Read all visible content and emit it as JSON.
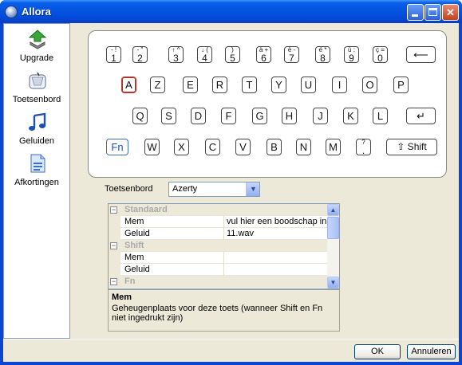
{
  "window": {
    "title": "Allora"
  },
  "sidebar": {
    "items": [
      {
        "label": "Upgrade",
        "icon": "upgrade-arrow-icon"
      },
      {
        "label": "Toetsenbord",
        "icon": "mouse-icon"
      },
      {
        "label": "Geluiden",
        "icon": "music-note-icon"
      },
      {
        "label": "Afkortingen",
        "icon": "document-icon"
      }
    ]
  },
  "keyboard": {
    "row1": [
      {
        "top": "- !",
        "bot": "1"
      },
      {
        "top": "- \"",
        "bot": "2"
      },
      {
        "top": "↑ ^",
        "bot": "3"
      },
      {
        "top": "↓ (",
        "bot": "4"
      },
      {
        "top": ")",
        "bot": "5"
      },
      {
        "top": "à +",
        "bot": "6"
      },
      {
        "top": "è -",
        "bot": "7"
      },
      {
        "top": "é *",
        "bot": "8"
      },
      {
        "top": "ù :",
        "bot": "9"
      },
      {
        "top": "ç =",
        "bot": "0"
      }
    ],
    "backspace": "⟵",
    "row2": [
      "A",
      "Z",
      "E",
      "R",
      "T",
      "Y",
      "U",
      "I",
      "O",
      "P"
    ],
    "row3": [
      "Q",
      "S",
      "D",
      "F",
      "G",
      "H",
      "J",
      "K",
      "L"
    ],
    "enter": "↵",
    "fn": "Fn",
    "row4": [
      "W",
      "X",
      "C",
      "V",
      "B",
      "N",
      "M"
    ],
    "punct": {
      "top": "?",
      "bot": "."
    },
    "shift": "⇧ Shift",
    "selected": "A"
  },
  "layout": {
    "label": "Toetsenbord",
    "value": "Azerty"
  },
  "properties": {
    "rows": [
      {
        "type": "cat",
        "label": "Standaard"
      },
      {
        "type": "prop",
        "name": "Mem",
        "value": "vul hier een boodschap in"
      },
      {
        "type": "prop",
        "name": "Geluid",
        "value": "11.wav"
      },
      {
        "type": "cat",
        "label": "Shift"
      },
      {
        "type": "prop",
        "name": "Mem",
        "value": ""
      },
      {
        "type": "prop",
        "name": "Geluid",
        "value": ""
      },
      {
        "type": "cat",
        "label": "Fn"
      }
    ]
  },
  "help": {
    "title": "Mem",
    "description": "Geheugenplaats voor deze toets (wanneer Shift en Fn niet ingedrukt zijn)"
  },
  "buttons": {
    "ok": "OK",
    "cancel": "Annuleren"
  }
}
